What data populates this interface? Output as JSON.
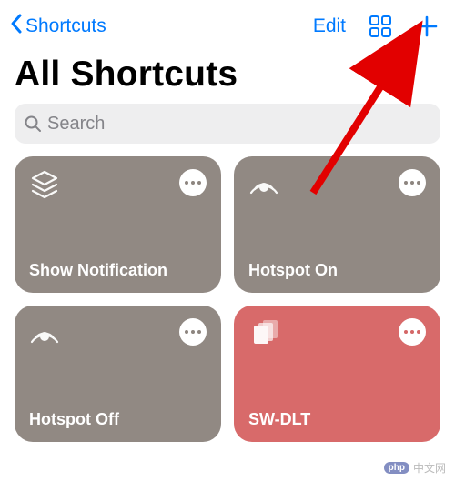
{
  "nav": {
    "back_label": "Shortcuts",
    "edit_label": "Edit"
  },
  "title": "All Shortcuts",
  "search": {
    "placeholder": "Search",
    "value": ""
  },
  "tiles": [
    {
      "label": "Show Notification",
      "icon": "layers-icon",
      "bg": "#918983",
      "dot": "#8d857f"
    },
    {
      "label": "Hotspot On",
      "icon": "hotspot-icon",
      "bg": "#918983",
      "dot": "#8d857f"
    },
    {
      "label": "Hotspot Off",
      "icon": "hotspot-icon",
      "bg": "#918983",
      "dot": "#8d857f"
    },
    {
      "label": "SW-DLT",
      "icon": "cards-icon",
      "bg": "#d86a6a",
      "dot": "#d46767"
    }
  ],
  "watermark": {
    "php": "php",
    "text": "中文网"
  }
}
